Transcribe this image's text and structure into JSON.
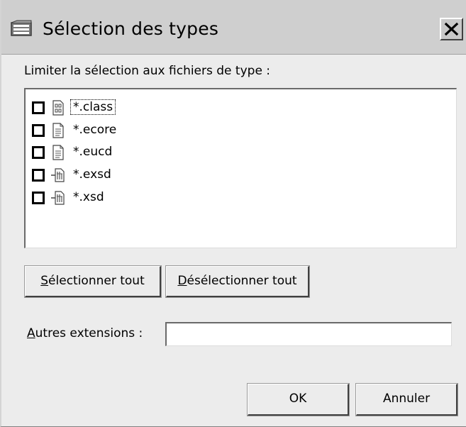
{
  "window": {
    "title": "Sélection des types",
    "icon": "eclipse-window-icon",
    "close_icon": "close-icon"
  },
  "prompt": "Limiter la sélection aux fichiers de type :",
  "file_types": [
    {
      "label": "*.class",
      "checked": false,
      "icon": "class-file-icon",
      "focused": true
    },
    {
      "label": "*.ecore",
      "checked": false,
      "icon": "text-file-icon",
      "focused": false
    },
    {
      "label": "*.eucd",
      "checked": false,
      "icon": "text-file-icon",
      "focused": false
    },
    {
      "label": "*.exsd",
      "checked": false,
      "icon": "schema-file-icon",
      "focused": false
    },
    {
      "label": "*.xsd",
      "checked": false,
      "icon": "schema-file-icon",
      "focused": false
    }
  ],
  "buttons": {
    "select_all": {
      "mnemonic": "S",
      "rest": "électionner tout"
    },
    "deselect_all": {
      "mnemonic": "D",
      "rest": "ésélectionner tout"
    },
    "ok": "OK",
    "cancel": "Annuler"
  },
  "other_extensions": {
    "label_mnemonic": "A",
    "label_rest": "utres extensions :",
    "value": ""
  }
}
